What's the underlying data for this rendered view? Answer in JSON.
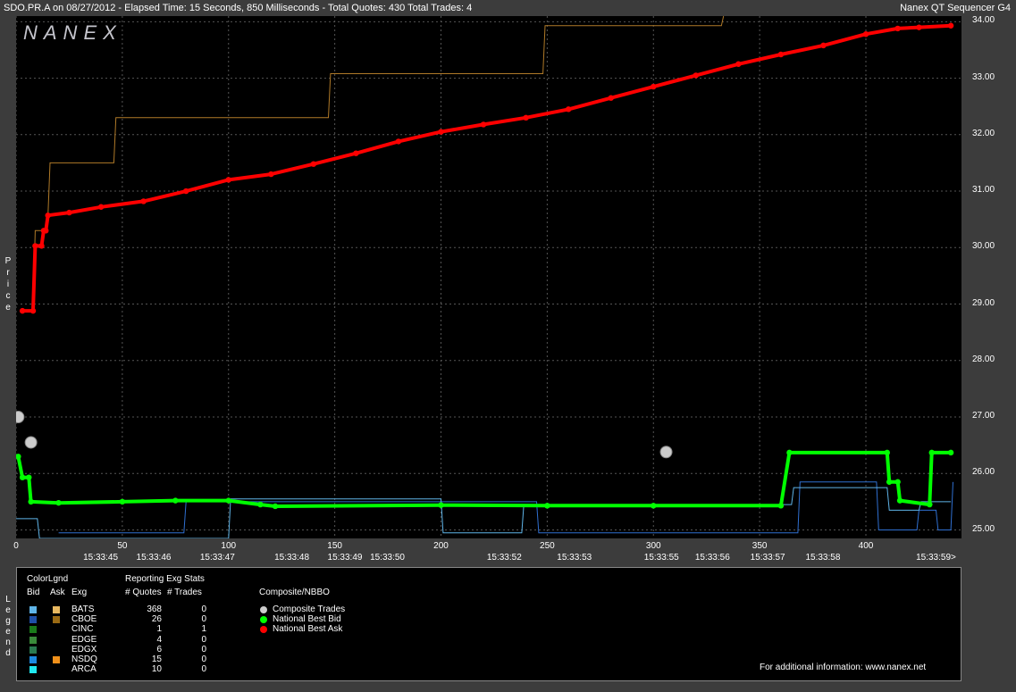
{
  "header": {
    "title": "SDO.PR.A on 08/27/2012  -  Elapsed Time: 15 Seconds, 850 Milliseconds  -  Total Quotes: 430  Total Trades: 4",
    "product": "Nanex QT Sequencer G4",
    "logo": "NANEX"
  },
  "y_axis_label": "Price",
  "legend_side_label": "Legend",
  "colors": {
    "ask": "#ff0000",
    "bid": "#00ff00",
    "trade": "#cccccc",
    "cboe_ask_line": "#b07a28",
    "bats_bid_line": "#5fb4e8",
    "cboe_bid_line": "#2f6fd0",
    "grid": "#555555"
  },
  "chart_data": {
    "type": "line",
    "title": "SDO.PR.A on 08/27/2012",
    "xlabel": "",
    "ylabel": "Price",
    "xlim": [
      0,
      445
    ],
    "ylim": [
      24.85,
      34.1
    ],
    "grid": true,
    "x_ticks": [
      0,
      50,
      100,
      150,
      200,
      250,
      300,
      350,
      400
    ],
    "y_ticks": [
      "25.00",
      "26.00",
      "27.00",
      "28.00",
      "29.00",
      "30.00",
      "31.00",
      "32.00",
      "33.00",
      "34.00"
    ],
    "time_labels": [
      {
        "x": 40,
        "label": "15:33:45"
      },
      {
        "x": 65,
        "label": "15:33:46"
      },
      {
        "x": 95,
        "label": "15:33:47"
      },
      {
        "x": 130,
        "label": "15:33:48"
      },
      {
        "x": 155,
        "label": "15:33:49"
      },
      {
        "x": 175,
        "label": "15:33:50"
      },
      {
        "x": 230,
        "label": "15:33:52"
      },
      {
        "x": 263,
        "label": "15:33:53"
      },
      {
        "x": 304,
        "label": "15:33:55"
      },
      {
        "x": 328,
        "label": "15:33:56"
      },
      {
        "x": 354,
        "label": "15:33:57"
      },
      {
        "x": 380,
        "label": "15:33:58"
      },
      {
        "x": 432,
        "label": "15:33:59>"
      }
    ],
    "series": [
      {
        "name": "National Best Ask",
        "points": [
          [
            3,
            28.88
          ],
          [
            8,
            28.88
          ],
          [
            9,
            30.03
          ],
          [
            12,
            30.03
          ],
          [
            13,
            30.3
          ],
          [
            14,
            30.3
          ],
          [
            15,
            30.57
          ],
          [
            25,
            30.62
          ],
          [
            40,
            30.72
          ],
          [
            60,
            30.82
          ],
          [
            80,
            31.0
          ],
          [
            100,
            31.2
          ],
          [
            120,
            31.3
          ],
          [
            140,
            31.48
          ],
          [
            160,
            31.67
          ],
          [
            180,
            31.88
          ],
          [
            200,
            32.05
          ],
          [
            220,
            32.18
          ],
          [
            240,
            32.3
          ],
          [
            260,
            32.45
          ],
          [
            280,
            32.65
          ],
          [
            300,
            32.85
          ],
          [
            320,
            33.05
          ],
          [
            340,
            33.25
          ],
          [
            360,
            33.42
          ],
          [
            380,
            33.58
          ],
          [
            400,
            33.78
          ],
          [
            415,
            33.88
          ],
          [
            425,
            33.9
          ],
          [
            440,
            33.93
          ]
        ]
      },
      {
        "name": "National Best Bid",
        "points": [
          [
            1,
            26.3
          ],
          [
            3,
            25.93
          ],
          [
            6,
            25.93
          ],
          [
            7,
            25.5
          ],
          [
            20,
            25.48
          ],
          [
            50,
            25.5
          ],
          [
            75,
            25.52
          ],
          [
            100,
            25.52
          ],
          [
            115,
            25.45
          ],
          [
            122,
            25.42
          ],
          [
            200,
            25.44
          ],
          [
            250,
            25.43
          ],
          [
            300,
            25.43
          ],
          [
            360,
            25.43
          ],
          [
            364,
            26.37
          ],
          [
            410,
            26.37
          ],
          [
            411,
            25.85
          ],
          [
            415,
            25.85
          ],
          [
            416,
            25.52
          ],
          [
            430,
            25.45
          ],
          [
            431,
            26.37
          ],
          [
            440,
            26.37
          ]
        ]
      },
      {
        "name": "CBOE Ask",
        "points": [
          [
            8,
            28.88
          ],
          [
            9,
            30.3
          ],
          [
            14,
            30.3
          ],
          [
            15,
            30.57
          ],
          [
            16,
            31.5
          ],
          [
            46,
            31.5
          ],
          [
            47,
            32.3
          ],
          [
            147,
            32.3
          ],
          [
            148,
            33.08
          ],
          [
            248,
            33.08
          ],
          [
            249,
            33.93
          ],
          [
            332,
            33.93
          ],
          [
            333,
            34.1
          ]
        ]
      },
      {
        "name": "BATS Bid",
        "points": [
          [
            0,
            25.2
          ],
          [
            10,
            25.2
          ],
          [
            11,
            24.85
          ],
          [
            100,
            24.85
          ],
          [
            101,
            25.55
          ],
          [
            200,
            25.55
          ],
          [
            201,
            24.95
          ],
          [
            238,
            24.95
          ],
          [
            239,
            25.45
          ],
          [
            365,
            25.45
          ],
          [
            366,
            25.75
          ],
          [
            410,
            25.75
          ],
          [
            411,
            25.35
          ],
          [
            425,
            25.35
          ],
          [
            426,
            25.5
          ],
          [
            440,
            25.5
          ]
        ]
      },
      {
        "name": "CBOE Bid",
        "points": [
          [
            20,
            24.95
          ],
          [
            79,
            24.95
          ],
          [
            80,
            25.5
          ],
          [
            245,
            25.5
          ],
          [
            246,
            24.95
          ],
          [
            368,
            24.95
          ],
          [
            369,
            25.85
          ],
          [
            405,
            25.85
          ],
          [
            406,
            25.0
          ],
          [
            424,
            25.0
          ],
          [
            425,
            25.35
          ],
          [
            433,
            25.35
          ],
          [
            434,
            25.0
          ],
          [
            440,
            25.0
          ],
          [
            441,
            25.85
          ]
        ]
      }
    ],
    "trades": [
      [
        1,
        27.0
      ],
      [
        7,
        26.55
      ],
      [
        306,
        26.38
      ]
    ]
  },
  "legend": {
    "color_legend": "ColorLgnd",
    "bid": "Bid",
    "ask": "Ask",
    "exg": "Exg",
    "reporting": "Reporting Exg Stats",
    "quotes": "# Quotes",
    "trades": "# Trades",
    "composite_header": "Composite/NBBO",
    "exchanges": [
      {
        "name": "BATS",
        "quotes": "368",
        "trades": "0",
        "bid_color": "#5fb4e8",
        "ask_color": "#e8b860"
      },
      {
        "name": "CBOE",
        "quotes": "26",
        "trades": "0",
        "bid_color": "#1f4fa8",
        "ask_color": "#9a6a14"
      },
      {
        "name": "CINC",
        "quotes": "1",
        "trades": "1",
        "bid_color": "#1a7a1a",
        "ask_color": ""
      },
      {
        "name": "EDGE",
        "quotes": "4",
        "trades": "0",
        "bid_color": "#3a8a3a",
        "ask_color": ""
      },
      {
        "name": "EDGX",
        "quotes": "6",
        "trades": "0",
        "bid_color": "#2a7a50",
        "ask_color": ""
      },
      {
        "name": "NSDQ",
        "quotes": "15",
        "trades": "0",
        "bid_color": "#1c8ae0",
        "ask_color": "#f0901a"
      },
      {
        "name": "ARCA",
        "quotes": "10",
        "trades": "0",
        "bid_color": "#20e8f0",
        "ask_color": ""
      }
    ],
    "composite": [
      {
        "label": "Composite Trades",
        "color": "#cccccc"
      },
      {
        "label": "National Best Bid",
        "color": "#00ff00"
      },
      {
        "label": "National Best Ask",
        "color": "#ff0000"
      }
    ],
    "footer": "For additional information: www.nanex.net"
  }
}
